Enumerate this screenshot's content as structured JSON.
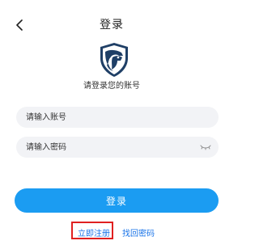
{
  "header": {
    "title": "登录",
    "back_icon": "chevron-left-icon"
  },
  "logo": {
    "icon": "eagle-shield-logo"
  },
  "subtitle": "请登录您的账号",
  "form": {
    "account": {
      "placeholder": "请输入账号",
      "value": ""
    },
    "password": {
      "placeholder": "请输入密码",
      "value": "",
      "toggle_icon": "eye-closed-icon"
    }
  },
  "login_button": {
    "label": "登录"
  },
  "links": {
    "register": "立即注册",
    "forgot_password": "找回密码"
  },
  "colors": {
    "primary": "#1b9cf2",
    "link": "#1a74e8",
    "input_bg": "#f2f3f6",
    "highlight": "#e02020"
  }
}
